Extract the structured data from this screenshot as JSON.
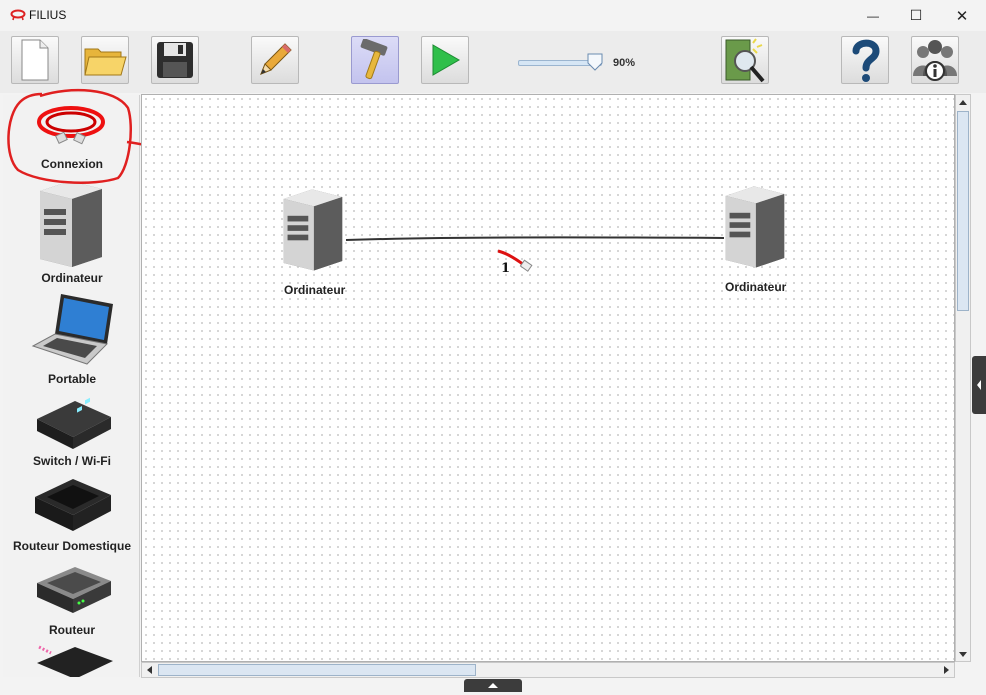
{
  "window": {
    "title": "FILIUS",
    "minimize_glyph": "—",
    "maximize_glyph": "☐",
    "close_glyph": "✕"
  },
  "toolbar": {
    "new_icon": "new-file-icon",
    "open_icon": "open-folder-icon",
    "save_icon": "floppy-disk-icon",
    "design_icon": "pencil-icon",
    "design_mode_active": true,
    "simulation_icon": "play-icon",
    "wizard_icon": "magic-wand-icon",
    "help_icon": "question-mark-icon",
    "about_icon": "people-info-icon",
    "zoom_percent": 90,
    "zoom_label": "90%"
  },
  "palette": {
    "items": [
      {
        "label": "Connexion",
        "icon": "network-cable-icon"
      },
      {
        "label": "Ordinateur",
        "icon": "computer-tower-icon"
      },
      {
        "label": "Portable",
        "icon": "laptop-icon"
      },
      {
        "label": "Switch / Wi-Fi",
        "icon": "switch-icon"
      },
      {
        "label": "Routeur Domestique",
        "icon": "home-router-icon"
      },
      {
        "label": "Routeur",
        "icon": "router-icon"
      }
    ]
  },
  "canvas": {
    "nodes": [
      {
        "label": "Ordinateur",
        "icon": "computer-tower-icon"
      },
      {
        "label": "Ordinateur",
        "icon": "computer-tower-icon"
      }
    ],
    "cursor_label": "1"
  },
  "colors": {
    "annotation": "#e02020",
    "play_green": "#2fbf4a",
    "active_mode": "#c3c3ee"
  }
}
